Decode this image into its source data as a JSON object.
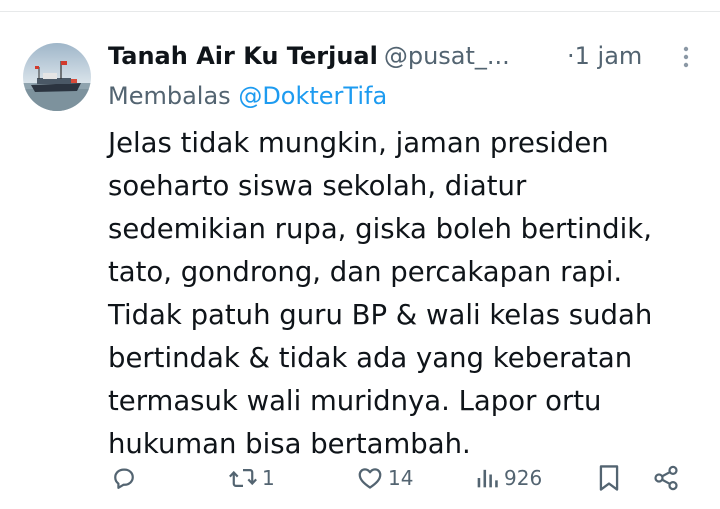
{
  "tweet": {
    "author_name": "Tanah Air Ku Terjual",
    "handle": "@pusat_...",
    "time": "·1 jam",
    "reply_prefix": "Membalas",
    "reply_mention": "@DokterTifa",
    "body_lines": [
      "Jelas tidak mungkin, jaman presiden",
      "soeharto siswa sekolah, diatur",
      "sedemikian rupa, giska boleh bertindik,",
      "tato, gondrong, dan percakapan rapi.",
      "Tidak patuh guru BP & wali kelas sudah",
      "bertindak & tidak ada yang keberatan",
      "termasuk wali muridnya. Lapor ortu",
      "hukuman bisa bertambah."
    ]
  },
  "actions": {
    "reply_count": "",
    "retweet_count": "1",
    "like_count": "14",
    "views_count": "926"
  },
  "icons": {
    "reply": "reply-icon",
    "retweet": "retweet-icon",
    "like": "heart-icon",
    "views": "views-icon",
    "bookmark": "bookmark-icon",
    "share": "share-icon",
    "more": "more-vertical-icon"
  },
  "colors": {
    "text": "#0f1419",
    "secondary": "#536471",
    "link": "#1d9bf0",
    "divider": "#e7e9ea"
  }
}
